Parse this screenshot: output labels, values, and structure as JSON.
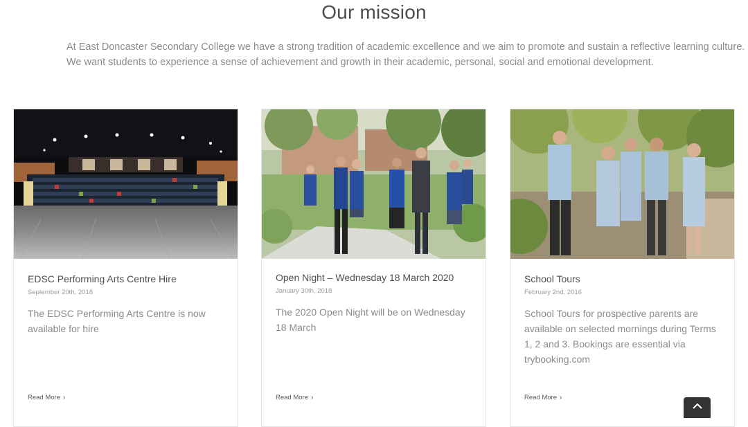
{
  "mission": {
    "title": "Our mission",
    "line1": "At East Doncaster Secondary College we have a strong tradition of academic excellence and we aim to promote and sustain a reflective learning culture.",
    "line2": "We want students to experience a sense of achievement and growth in their academic, personal, social and emotional development."
  },
  "posts": [
    {
      "title": "EDSC Performing Arts Centre Hire",
      "date": "September 20th, 2018",
      "excerpt": "The EDSC Performing Arts Centre is now available for hire",
      "read_more": "Read More",
      "image": "performing-arts-theatre-photo"
    },
    {
      "title": "Open Night – Wednesday 18 March 2020",
      "date": "January 30th, 2018",
      "excerpt": "The 2020 Open Night will be on Wednesday 18 March",
      "read_more": "Read More",
      "image": "students-with-teacher-photo"
    },
    {
      "title": "School Tours",
      "date": "February 2nd, 2016",
      "excerpt": "School Tours for prospective parents are available on selected mornings during Terms 1, 2 and 3. Bookings are essential via trybooking.com",
      "read_more": "Read More",
      "image": "students-walking-photo"
    }
  ],
  "icons": {
    "read_more": "chevron-right-icon",
    "to_top": "chevron-up-icon"
  },
  "colors": {
    "to_top_bg": "#333333",
    "card_border": "#e6e6e6",
    "title_text": "#4d4d4d"
  }
}
